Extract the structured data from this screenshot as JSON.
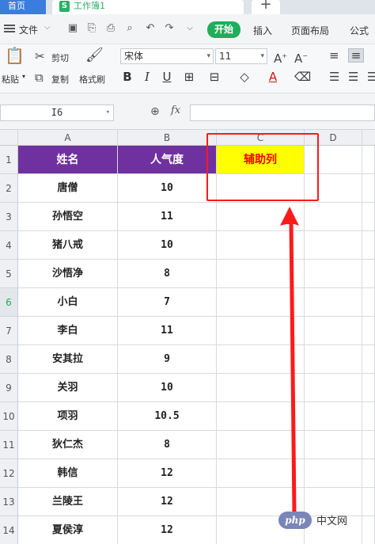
{
  "tabs": {
    "home": "首页",
    "document": "工作簿1",
    "document_icon": "S",
    "add": "+"
  },
  "menu": {
    "file": "文件",
    "items": [
      "开始",
      "插入",
      "页面布局",
      "公式"
    ]
  },
  "ribbon": {
    "paste": "粘贴",
    "cut": "剪切",
    "copy": "复制",
    "format_painter": "格式刷",
    "font_name": "宋体",
    "font_size": "11",
    "grow_font": "A",
    "shrink_font": "A",
    "bold": "B",
    "italic": "I",
    "underline": "U",
    "font_color_glyph": "A"
  },
  "formula_bar": {
    "cell_ref": "I6",
    "fx": "fx",
    "value": ""
  },
  "columns": [
    "A",
    "B",
    "C",
    "D"
  ],
  "selected_row": "6",
  "rows": [
    {
      "num": "1",
      "name": "姓名",
      "pop": "人气度",
      "helper": "辅助列"
    },
    {
      "num": "2",
      "name": "唐僧",
      "pop": "10",
      "helper": ""
    },
    {
      "num": "3",
      "name": "孙悟空",
      "pop": "11",
      "helper": ""
    },
    {
      "num": "4",
      "name": "猪八戒",
      "pop": "10",
      "helper": ""
    },
    {
      "num": "5",
      "name": "沙悟净",
      "pop": "8",
      "helper": ""
    },
    {
      "num": "6",
      "name": "小白",
      "pop": "7",
      "helper": ""
    },
    {
      "num": "7",
      "name": "李白",
      "pop": "11",
      "helper": ""
    },
    {
      "num": "8",
      "name": "安其拉",
      "pop": "9",
      "helper": ""
    },
    {
      "num": "9",
      "name": "关羽",
      "pop": "10",
      "helper": ""
    },
    {
      "num": "10",
      "name": "项羽",
      "pop": "10.5",
      "helper": ""
    },
    {
      "num": "11",
      "name": "狄仁杰",
      "pop": "8",
      "helper": ""
    },
    {
      "num": "12",
      "name": "韩信",
      "pop": "12",
      "helper": ""
    },
    {
      "num": "13",
      "name": "兰陵王",
      "pop": "12",
      "helper": ""
    },
    {
      "num": "14",
      "name": "夏侯淳",
      "pop": "12",
      "helper": ""
    }
  ],
  "colors": {
    "header_fill": "#7031a0",
    "helper_fill": "#ffff00",
    "helper_text": "#ff0000",
    "annotation": "#ff1a1a",
    "accent": "#1fae5b"
  },
  "watermark": {
    "logo": "php",
    "text": "中文网"
  }
}
